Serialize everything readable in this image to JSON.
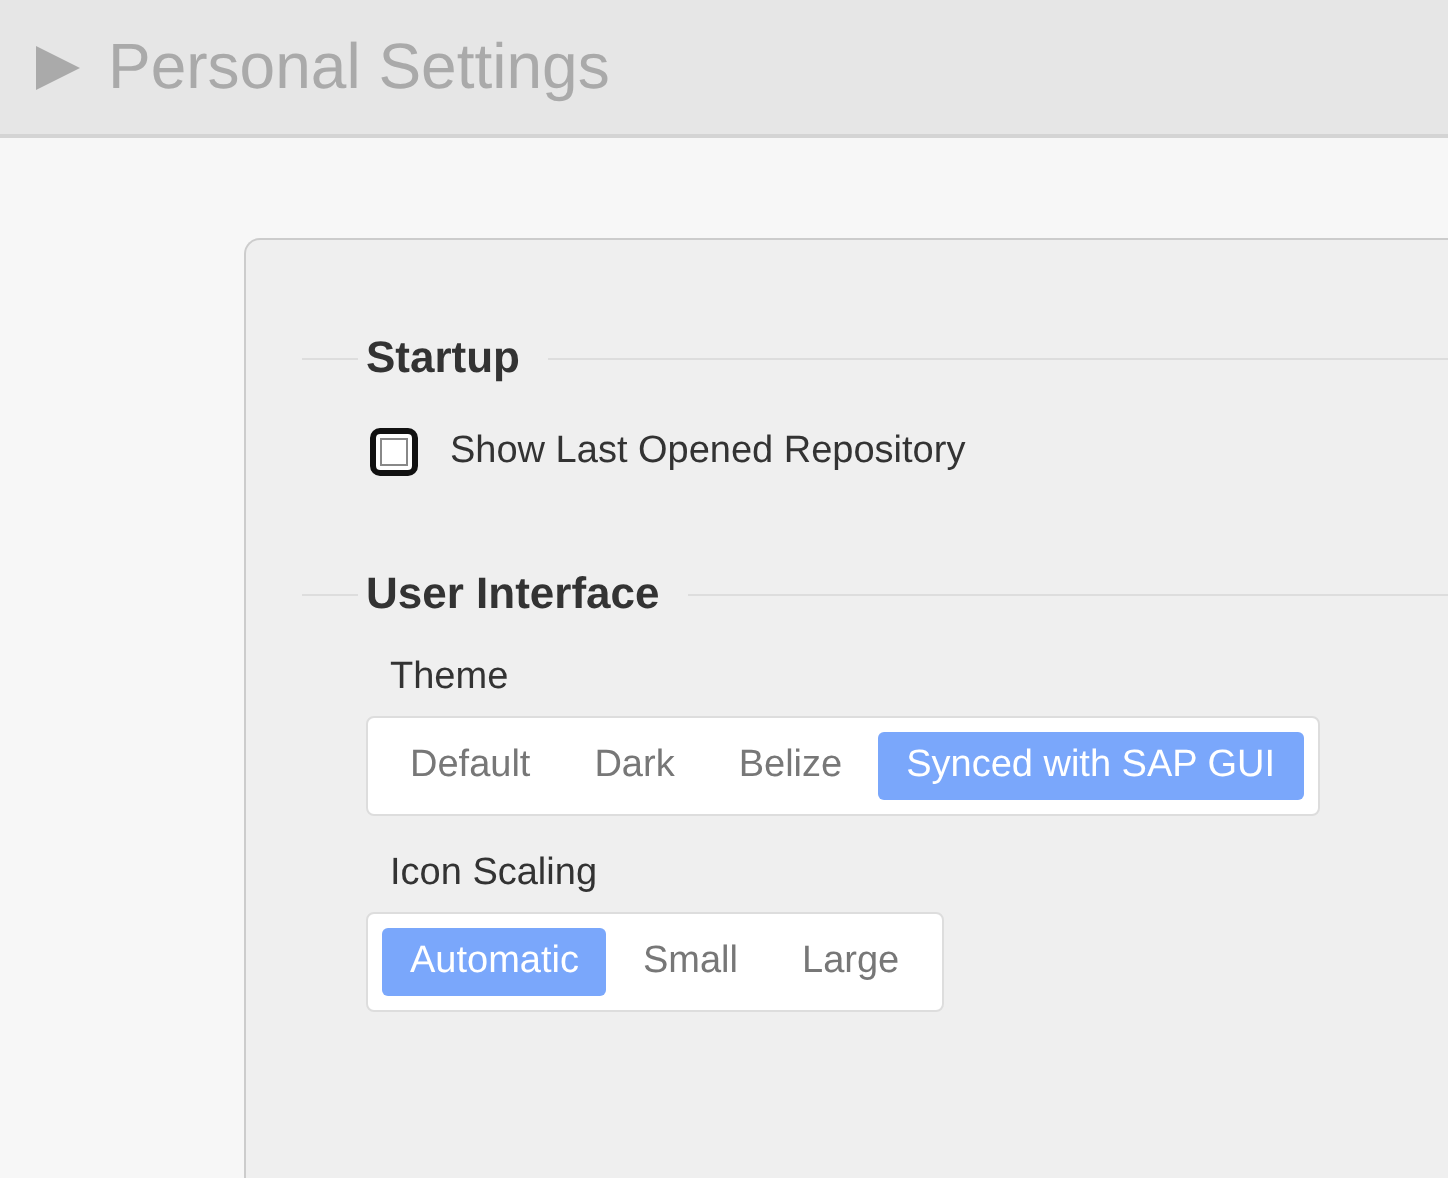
{
  "header": {
    "title": "Personal Settings"
  },
  "sections": [
    {
      "title": "Startup",
      "items": [
        {
          "kind": "checkbox",
          "label": "Show Last Opened Repository",
          "checked": false
        }
      ]
    },
    {
      "title": "User Interface",
      "items": [
        {
          "kind": "segmented",
          "label": "Theme",
          "options": [
            {
              "label": "Default",
              "selected": false
            },
            {
              "label": "Dark",
              "selected": false
            },
            {
              "label": "Belize",
              "selected": false
            },
            {
              "label": "Synced with SAP GUI",
              "selected": true
            }
          ]
        },
        {
          "kind": "segmented",
          "label": "Icon Scaling",
          "options": [
            {
              "label": "Automatic",
              "selected": true
            },
            {
              "label": "Small",
              "selected": false
            },
            {
              "label": "Large",
              "selected": false
            }
          ]
        }
      ]
    }
  ]
}
